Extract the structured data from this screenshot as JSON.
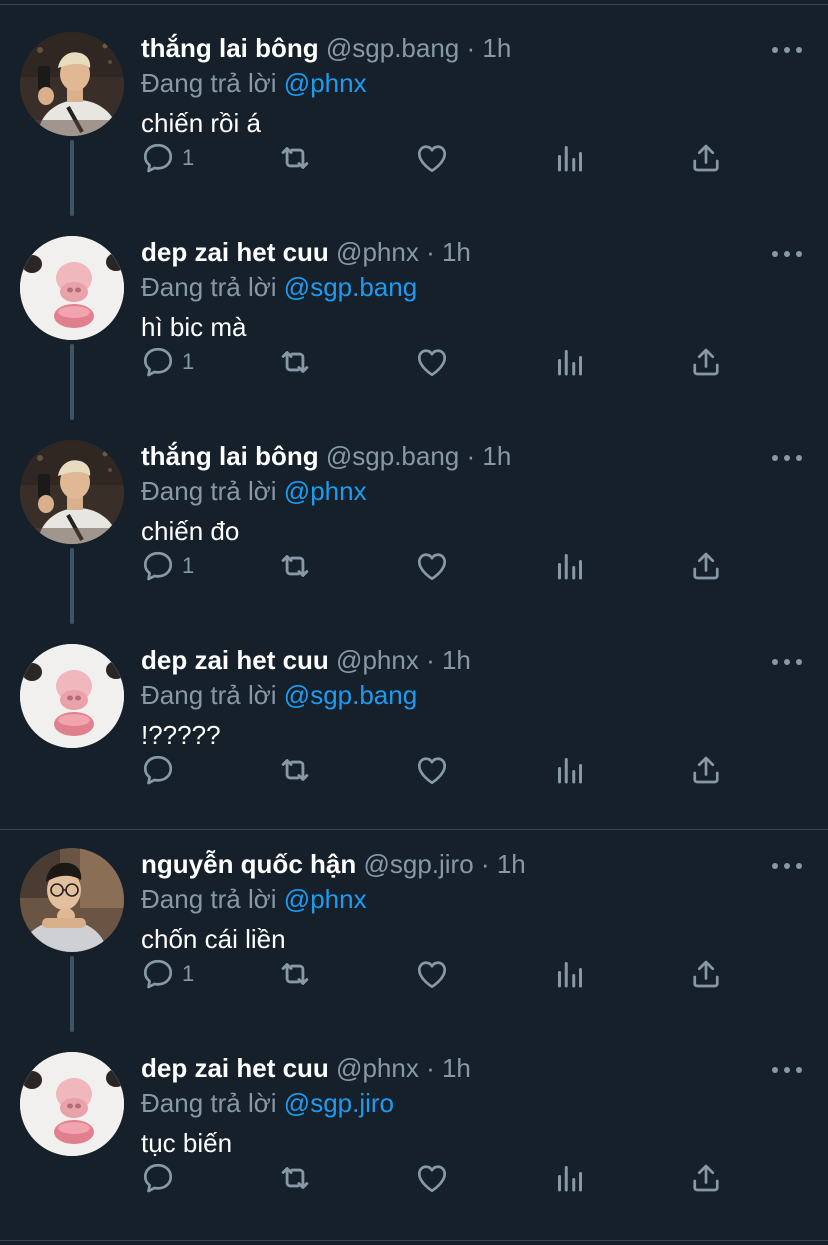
{
  "reply_prefix": "Đang trả lời",
  "colors": {
    "background": "#15202b",
    "secondary_text": "#8899a6",
    "mention": "#1d9bf0",
    "divider": "#38444d"
  },
  "tweets": [
    {
      "display_name": "thắng lai bông",
      "handle": "@sgp.bang",
      "time": "1h",
      "reply_to": "@phnx",
      "text": "chiến rồi á",
      "reply_count": "1",
      "avatar": "person-photo-avatar"
    },
    {
      "display_name": "dep zai het cuu",
      "handle": "@phnx",
      "time": "1h",
      "reply_to": "@sgp.bang",
      "text": "hì bic mà",
      "reply_count": "1",
      "avatar": "hamster-avatar"
    },
    {
      "display_name": "thắng lai bông",
      "handle": "@sgp.bang",
      "time": "1h",
      "reply_to": "@phnx",
      "text": "chiến đo",
      "reply_count": "1",
      "avatar": "person-photo-avatar"
    },
    {
      "display_name": "dep zai het cuu",
      "handle": "@phnx",
      "time": "1h",
      "reply_to": "@sgp.bang",
      "text": "!?????",
      "reply_count": "",
      "avatar": "hamster-avatar"
    },
    {
      "display_name": "nguyễn quốc hận",
      "handle": "@sgp.jiro",
      "time": "1h",
      "reply_to": "@phnx",
      "text": "chốn cái liền",
      "reply_count": "1",
      "avatar": "glasses-person-avatar"
    },
    {
      "display_name": "dep zai het cuu",
      "handle": "@phnx",
      "time": "1h",
      "reply_to": "@sgp.jiro",
      "text": "tục biến",
      "reply_count": "",
      "avatar": "hamster-avatar"
    }
  ]
}
